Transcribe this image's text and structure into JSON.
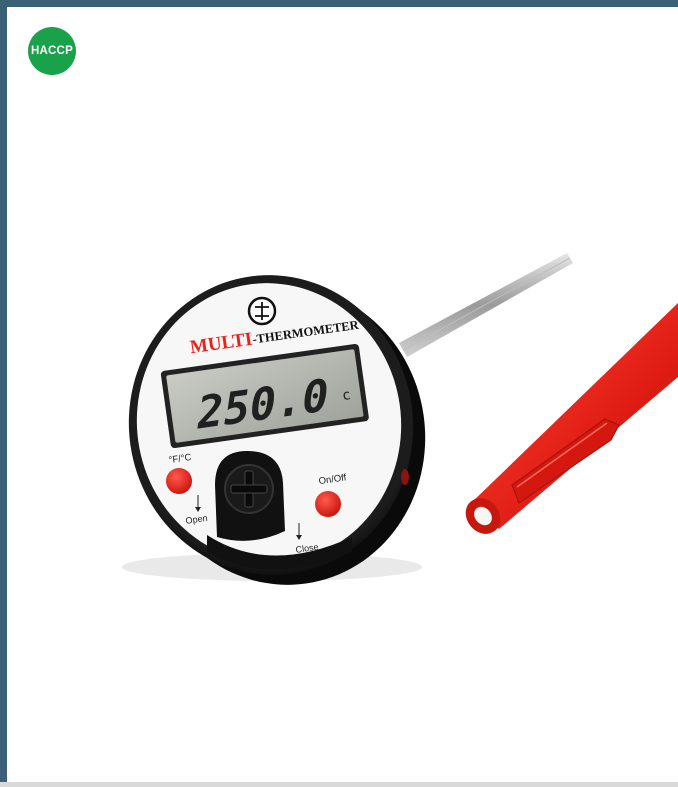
{
  "badge": {
    "label": "HACCP",
    "color": "#1aa24b"
  },
  "frame": {
    "accent_color": "#3b6178"
  },
  "thermometer": {
    "brand_word1": "MULTI",
    "brand_word2": "-THERMOMETER",
    "display_reading": "250.0",
    "unit_symbol": "c",
    "button_left_label": "°F/°C",
    "button_right_label": "On/Off",
    "open_label": "Open",
    "close_label": "Close",
    "body_color": "#111111",
    "button_color": "#e8231d",
    "sheath_color": "#e8231d"
  }
}
